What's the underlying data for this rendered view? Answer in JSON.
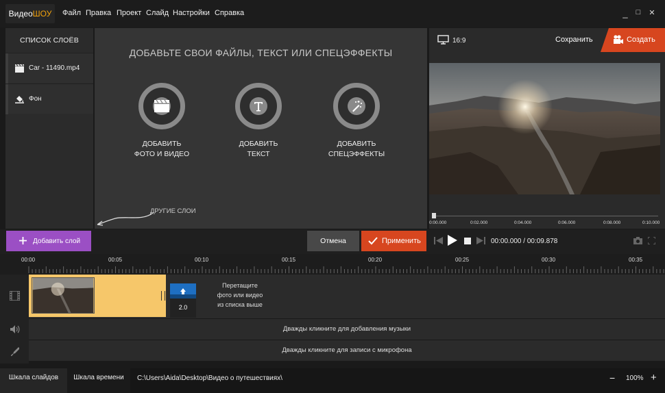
{
  "app": {
    "logo_left": "Видео",
    "logo_right": "ШОУ"
  },
  "menu": [
    "Файл",
    "Правка",
    "Проект",
    "Слайд",
    "Настройки",
    "Справка"
  ],
  "window": {
    "minimize": "_",
    "maximize": "□",
    "close": "✕"
  },
  "layers": {
    "title": "СПИСОК СЛОЁВ",
    "items": [
      {
        "label": "Car - 11490.mp4",
        "icon": "film-icon"
      },
      {
        "label": "Фон",
        "icon": "paint-bucket-icon"
      }
    ]
  },
  "center": {
    "title": "ДОБАВЬТЕ СВОИ ФАЙЛЫ, ТЕКСТ ИЛИ СПЕЦЭФФЕКТЫ",
    "actions": [
      {
        "line1": "ДОБАВИТЬ",
        "line2": "ФОТО И ВИДЕО",
        "icon": "clapperboard-icon"
      },
      {
        "line1": "ДОБАВИТЬ",
        "line2": "ТЕКСТ",
        "icon": "text-icon"
      },
      {
        "line1": "ДОБАВИТЬ",
        "line2": "СПЕЦЭФФЕКТЫ",
        "icon": "magic-wand-icon"
      }
    ],
    "other_layers": "ДРУГИЕ СЛОИ"
  },
  "preview": {
    "ratio": "16:9",
    "save": "Сохранить",
    "create": "Создать",
    "ruler": [
      "0:00.000",
      "0:02.000",
      "0:04.000",
      "0:06.000",
      "0:08.000",
      "0:10.000"
    ]
  },
  "actions": {
    "add_layer": "Добавить слой",
    "cancel": "Отмена",
    "apply": "Применить"
  },
  "player": {
    "current": "00:00.000",
    "total": "00:09.878",
    "separator": " / "
  },
  "timeline": {
    "ticks": [
      "00:00",
      "00:05",
      "00:10",
      "00:15",
      "00:20",
      "00:25",
      "00:30",
      "00:35"
    ],
    "transition_value": "2.0",
    "drop_hint": [
      "Перетащите",
      "фото или видео",
      "из списка выше"
    ],
    "music_hint": "Дважды кликните для добавления музыки",
    "mic_hint": "Дважды кликните для записи с микрофона"
  },
  "status": {
    "tab_slides": "Шкала слайдов",
    "tab_timeline": "Шкала времени",
    "path": "C:\\Users\\Aida\\Desktop\\Видео о путешествиях\\",
    "zoom": "100%",
    "zoom_minus": "−",
    "zoom_plus": "+"
  },
  "colors": {
    "accent_orange": "#d7461f",
    "accent_purple": "#9b4fc4",
    "clip_yellow": "#f6c76a",
    "logo_orange": "#f2a20c"
  }
}
